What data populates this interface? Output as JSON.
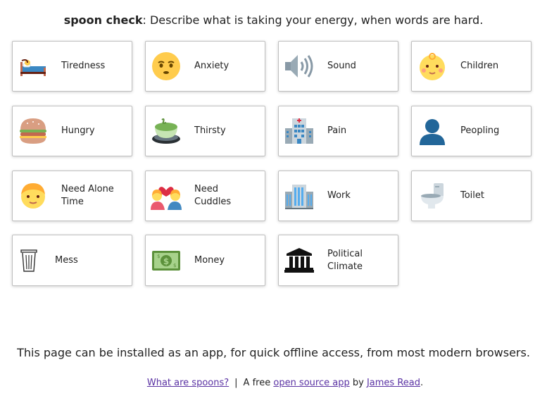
{
  "header": {
    "brand": "spoon check",
    "prompt": ": Describe what is taking your energy, when words are hard."
  },
  "cards": [
    {
      "label": "Tiredness",
      "icon": "bed-icon"
    },
    {
      "label": "Anxiety",
      "icon": "anxious-face-icon"
    },
    {
      "label": "Sound",
      "icon": "speaker-icon"
    },
    {
      "label": "Children",
      "icon": "baby-face-icon"
    },
    {
      "label": "Hungry",
      "icon": "burger-icon"
    },
    {
      "label": "Thirsty",
      "icon": "tea-cup-icon"
    },
    {
      "label": "Pain",
      "icon": "hospital-icon"
    },
    {
      "label": "Peopling",
      "icon": "person-silhouette-icon"
    },
    {
      "label": "Need Alone Time",
      "icon": "boy-face-icon"
    },
    {
      "label": "Need Cuddles",
      "icon": "couple-heart-icon"
    },
    {
      "label": "Work",
      "icon": "office-building-icon"
    },
    {
      "label": "Toilet",
      "icon": "toilet-icon"
    },
    {
      "label": "Mess",
      "icon": "wastebasket-icon"
    },
    {
      "label": "Money",
      "icon": "dollar-banknote-icon"
    },
    {
      "label": "Political Climate",
      "icon": "classical-building-icon"
    }
  ],
  "install_note": "This page can be installed as an app, for quick offline access, from most modern browsers.",
  "footer": {
    "spoons_link": "What are spoons?",
    "separator": "|",
    "free_text": "A free",
    "open_source_link": "open source app",
    "by_text": "by",
    "author_link": "James Read",
    "end": "."
  }
}
